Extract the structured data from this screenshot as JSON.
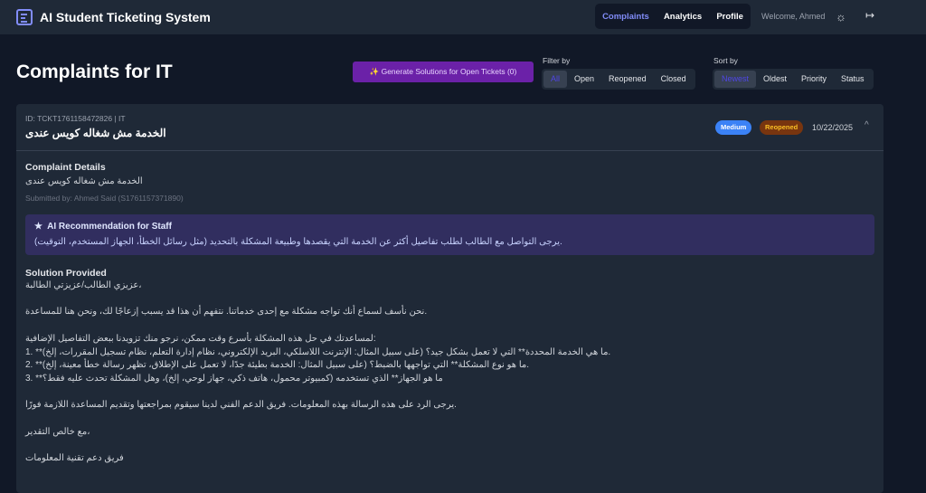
{
  "nav": {
    "brand": "AI Student Ticketing System",
    "tabs": [
      "Complaints",
      "Analytics",
      "Profile"
    ],
    "welcome": "Welcome, Ahmed"
  },
  "page": {
    "title": "Complaints for IT",
    "generate_label": "✨ Generate Solutions for Open Tickets (0)",
    "filter_label": "Filter by",
    "filters": [
      "All",
      "Open",
      "Reopened",
      "Closed"
    ],
    "sort_label": "Sort by",
    "sorts": [
      "Newest",
      "Oldest",
      "Priority",
      "Status"
    ]
  },
  "ticket": {
    "id": "ID: TCKT1761158472826 | IT",
    "title": "الخدمة مش شغاله كويس عندى",
    "priority": "Medium",
    "status": "Reopened",
    "date": "10/22/2025",
    "details_title": "Complaint Details",
    "details": "الخدمة مش شغاله كويس عندى",
    "submitted": "Submitted by: Ahmed Said (S1761157371890)",
    "ai_title": "AI Recommendation for Staff",
    "ai_text": "يرجى التواصل مع الطالب لطلب تفاصيل أكثر عن الخدمة التي يقصدها وطبيعة المشكلة بالتحديد (مثل رسائل الخطأ، الجهاز المستخدم، التوقيت).",
    "solution_title": "Solution Provided",
    "solution": "عزيزي الطالب/عزيزتي الطالبة،\n\nنحن نأسف لسماع أنك تواجه مشكلة مع إحدى خدماتنا. نتفهم أن هذا قد يسبب إزعاجًا لك، ونحن هنا للمساعدة.\n\nلمساعدتك في حل هذه المشكلة بأسرع وقت ممكن، نرجو منك تزويدنا ببعض التفاصيل الإضافية:\n1. **ما هي الخدمة المحددة** التي لا تعمل بشكل جيد؟ (على سبيل المثال: الإنترنت اللاسلكي، البريد الإلكتروني، نظام إدارة التعلم، نظام تسجيل المقررات، إلخ).\n2. **ما هو نوع المشكلة** التي تواجهها بالضبط؟ (على سبيل المثال: الخدمة بطيئة جدًا، لا تعمل على الإطلاق، تظهر رسالة خطأ معينة، إلخ).\n3. **ما هو الجهاز** الذي تستخدمه (كمبيوتر محمول، هاتف ذكي، جهاز لوحي، إلخ)، وهل المشكلة تحدث عليه فقط؟\n\nيرجى الرد على هذه الرسالة بهذه المعلومات. فريق الدعم الفني لدينا سيقوم بمراجعتها وتقديم المساعدة اللازمة فورًا.\n\nمع خالص التقدير،\n\nفريق دعم تقنية المعلومات"
  }
}
